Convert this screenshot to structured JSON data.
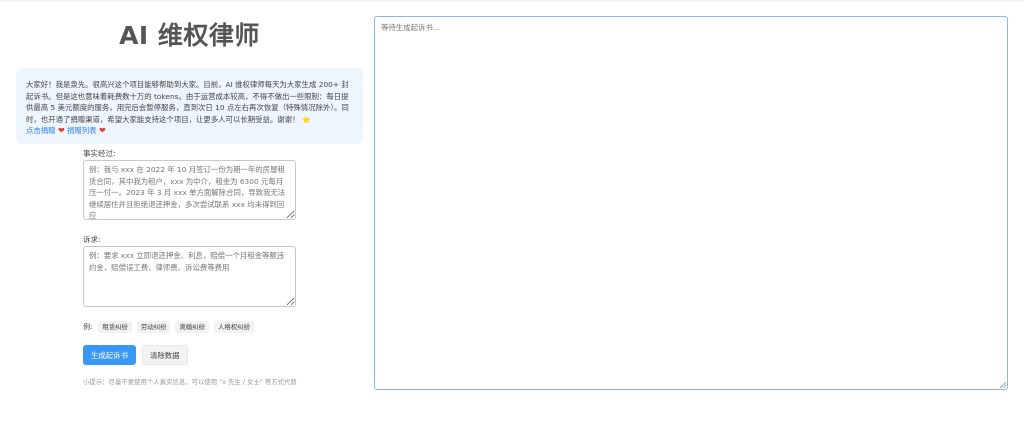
{
  "app": {
    "title": "AI 维权律师"
  },
  "notice": {
    "text": "大家好！我是泉先。很高兴这个项目能够帮助到大家。目前，AI 维权律师每天为大家生成 200+ 封起诉书。但是这也意味着耗费数十万的 tokens。由于运营成本较高，不得不做出一些限制：每日提供最高 5 美元额度的服务，用完后会暂停服务，直到次日 10 点左右再次恢复（特殊情况除外）。同时，也开通了捐赠渠道，希望大家能支持这个项目，让更多人可以长期受益。谢谢！",
    "star": "⭐",
    "donate_link": "点击捐赠",
    "donors_link": "捐赠列表",
    "heart": "❤"
  },
  "form": {
    "facts_label": "事实经过:",
    "facts_placeholder": "例：我与 xxx 在 2022 年 10 月签订一份为期一年的房屋租赁合同，其中我为租户，xxx 为中介，租金为 6300 元每月压一付一。2023 年 3 月 xxx 单方面解除合同，导致我无法继续居住并且拒绝退还押金，多次尝试联系 xxx 均未得到回应",
    "claims_label": "诉求:",
    "claims_placeholder": "例：要求 xxx 立即退还押金、利息，赔偿一个月租金等额违约金，赔偿误工费、律师费、诉讼费等费用",
    "examples_label": "例:",
    "examples": [
      "租赁纠纷",
      "劳动纠纷",
      "离婚纠纷",
      "人格权纠纷"
    ],
    "generate_button": "生成起诉书",
    "clear_button": "清除数据",
    "tip": "小提示：尽量不要使用个人真实信息，可以使用 \"x 先生 / 女士\" 等方式代替"
  },
  "output": {
    "placeholder": "等待生成起诉书..."
  }
}
